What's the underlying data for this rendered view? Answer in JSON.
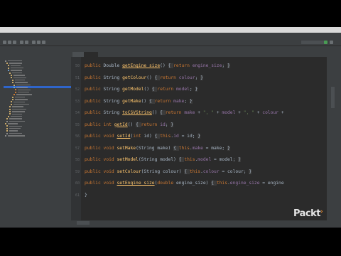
{
  "editor": {
    "lines": [
      {
        "num": "50",
        "parts": [
          {
            "t": "public ",
            "c": "kw"
          },
          {
            "t": "Double ",
            "c": ""
          },
          {
            "t": "getEngine_size",
            "c": "fn u"
          },
          {
            "t": "() ",
            "c": ""
          },
          {
            "t": "{ ",
            "c": "fold"
          },
          {
            "t": "return ",
            "c": "kw"
          },
          {
            "t": "engine_size",
            "c": "fld"
          },
          {
            "t": "; ",
            "c": ""
          },
          {
            "t": "}",
            "c": "fold"
          }
        ]
      },
      {
        "num": "51",
        "parts": [
          {
            "t": "public ",
            "c": "kw"
          },
          {
            "t": "String ",
            "c": ""
          },
          {
            "t": "getColour",
            "c": "fn"
          },
          {
            "t": "() ",
            "c": ""
          },
          {
            "t": "{ ",
            "c": "fold"
          },
          {
            "t": "return ",
            "c": "kw"
          },
          {
            "t": "colour",
            "c": "fld"
          },
          {
            "t": "; ",
            "c": ""
          },
          {
            "t": "}",
            "c": "fold"
          }
        ]
      },
      {
        "num": "52",
        "parts": [
          {
            "t": "public ",
            "c": "kw"
          },
          {
            "t": "String ",
            "c": ""
          },
          {
            "t": "getModel",
            "c": "fn"
          },
          {
            "t": "() ",
            "c": ""
          },
          {
            "t": "{ ",
            "c": "fold"
          },
          {
            "t": "return ",
            "c": "kw"
          },
          {
            "t": "model",
            "c": "fld"
          },
          {
            "t": "; ",
            "c": ""
          },
          {
            "t": "}",
            "c": "fold"
          }
        ]
      },
      {
        "num": "53",
        "parts": [
          {
            "t": "public ",
            "c": "kw"
          },
          {
            "t": "String ",
            "c": ""
          },
          {
            "t": "getMake",
            "c": "fn"
          },
          {
            "t": "() ",
            "c": ""
          },
          {
            "t": "{ ",
            "c": "fold"
          },
          {
            "t": "return ",
            "c": "kw"
          },
          {
            "t": "make",
            "c": "fld"
          },
          {
            "t": "; ",
            "c": ""
          },
          {
            "t": "}",
            "c": "fold"
          }
        ]
      },
      {
        "num": "54",
        "parts": [
          {
            "t": "public ",
            "c": "kw"
          },
          {
            "t": "String ",
            "c": ""
          },
          {
            "t": "toCSVString",
            "c": "fn u"
          },
          {
            "t": "() ",
            "c": ""
          },
          {
            "t": "{ ",
            "c": "fold"
          },
          {
            "t": "return ",
            "c": "kw"
          },
          {
            "t": "make",
            "c": "fld"
          },
          {
            "t": " + ",
            "c": ""
          },
          {
            "t": "\", \"",
            "c": "str"
          },
          {
            "t": " + ",
            "c": ""
          },
          {
            "t": "model",
            "c": "fld"
          },
          {
            "t": " + ",
            "c": ""
          },
          {
            "t": "\", \"",
            "c": "str"
          },
          {
            "t": " + ",
            "c": ""
          },
          {
            "t": "colour",
            "c": "fld"
          },
          {
            "t": " +",
            "c": ""
          }
        ]
      },
      {
        "num": "55",
        "parts": [
          {
            "t": "public ",
            "c": "kw"
          },
          {
            "t": "int ",
            "c": "kw"
          },
          {
            "t": "getId",
            "c": "fn u"
          },
          {
            "t": "() ",
            "c": ""
          },
          {
            "t": "{ ",
            "c": "fold"
          },
          {
            "t": "return ",
            "c": "kw"
          },
          {
            "t": "id",
            "c": "fld"
          },
          {
            "t": "; ",
            "c": ""
          },
          {
            "t": "}",
            "c": "fold"
          }
        ]
      },
      {
        "num": "56",
        "parts": [
          {
            "t": "public ",
            "c": "kw"
          },
          {
            "t": "void ",
            "c": "kw"
          },
          {
            "t": "setId",
            "c": "fn u"
          },
          {
            "t": "(",
            "c": ""
          },
          {
            "t": "int ",
            "c": "kw"
          },
          {
            "t": "id) ",
            "c": ""
          },
          {
            "t": "{ ",
            "c": "fold"
          },
          {
            "t": "this",
            "c": "kw"
          },
          {
            "t": ".",
            "c": ""
          },
          {
            "t": "id",
            "c": "fld"
          },
          {
            "t": " = id; ",
            "c": ""
          },
          {
            "t": "}",
            "c": "fold"
          }
        ]
      },
      {
        "num": "57",
        "parts": [
          {
            "t": "public ",
            "c": "kw"
          },
          {
            "t": "void ",
            "c": "kw"
          },
          {
            "t": "setMake",
            "c": "fn"
          },
          {
            "t": "(String make) ",
            "c": ""
          },
          {
            "t": "{ ",
            "c": "fold"
          },
          {
            "t": "this",
            "c": "kw"
          },
          {
            "t": ".",
            "c": ""
          },
          {
            "t": "make",
            "c": "fld"
          },
          {
            "t": " = make; ",
            "c": ""
          },
          {
            "t": "}",
            "c": "fold"
          }
        ]
      },
      {
        "num": "58",
        "parts": [
          {
            "t": "public ",
            "c": "kw"
          },
          {
            "t": "void ",
            "c": "kw"
          },
          {
            "t": "setModel",
            "c": "fn"
          },
          {
            "t": "(String model) ",
            "c": ""
          },
          {
            "t": "{ ",
            "c": "fold"
          },
          {
            "t": "this",
            "c": "kw"
          },
          {
            "t": ".",
            "c": ""
          },
          {
            "t": "model",
            "c": "fld"
          },
          {
            "t": " = model; ",
            "c": ""
          },
          {
            "t": "}",
            "c": "fold"
          }
        ]
      },
      {
        "num": "59",
        "parts": [
          {
            "t": "public ",
            "c": "kw"
          },
          {
            "t": "void ",
            "c": "kw"
          },
          {
            "t": "setColour",
            "c": "fn"
          },
          {
            "t": "(String colour) ",
            "c": ""
          },
          {
            "t": "{ ",
            "c": "fold"
          },
          {
            "t": "this",
            "c": "kw"
          },
          {
            "t": ".",
            "c": ""
          },
          {
            "t": "colour",
            "c": "fld"
          },
          {
            "t": " = colour; ",
            "c": ""
          },
          {
            "t": "}",
            "c": "fold"
          }
        ]
      },
      {
        "num": "60",
        "parts": [
          {
            "t": "public ",
            "c": "kw"
          },
          {
            "t": "void ",
            "c": "kw"
          },
          {
            "t": "setEngine_size",
            "c": "fn u"
          },
          {
            "t": "(",
            "c": ""
          },
          {
            "t": "double ",
            "c": "kw"
          },
          {
            "t": "engine_size) ",
            "c": ""
          },
          {
            "t": "{ ",
            "c": "fold"
          },
          {
            "t": "this",
            "c": "kw"
          },
          {
            "t": ".",
            "c": ""
          },
          {
            "t": "engine_size",
            "c": "fld"
          },
          {
            "t": " = engine",
            "c": ""
          }
        ]
      },
      {
        "num": "61",
        "parts": [
          {
            "t": "}",
            "c": ""
          }
        ]
      }
    ]
  },
  "branding": {
    "logo_text": "Packt",
    "logo_accent_color": "#f08c2b"
  },
  "colors": {
    "editor_bg": "#2b2b2b",
    "keyword": "#cc7832",
    "method": "#ffc66d",
    "field": "#9876aa",
    "string": "#6a8759",
    "plain": "#a9b7c6"
  }
}
